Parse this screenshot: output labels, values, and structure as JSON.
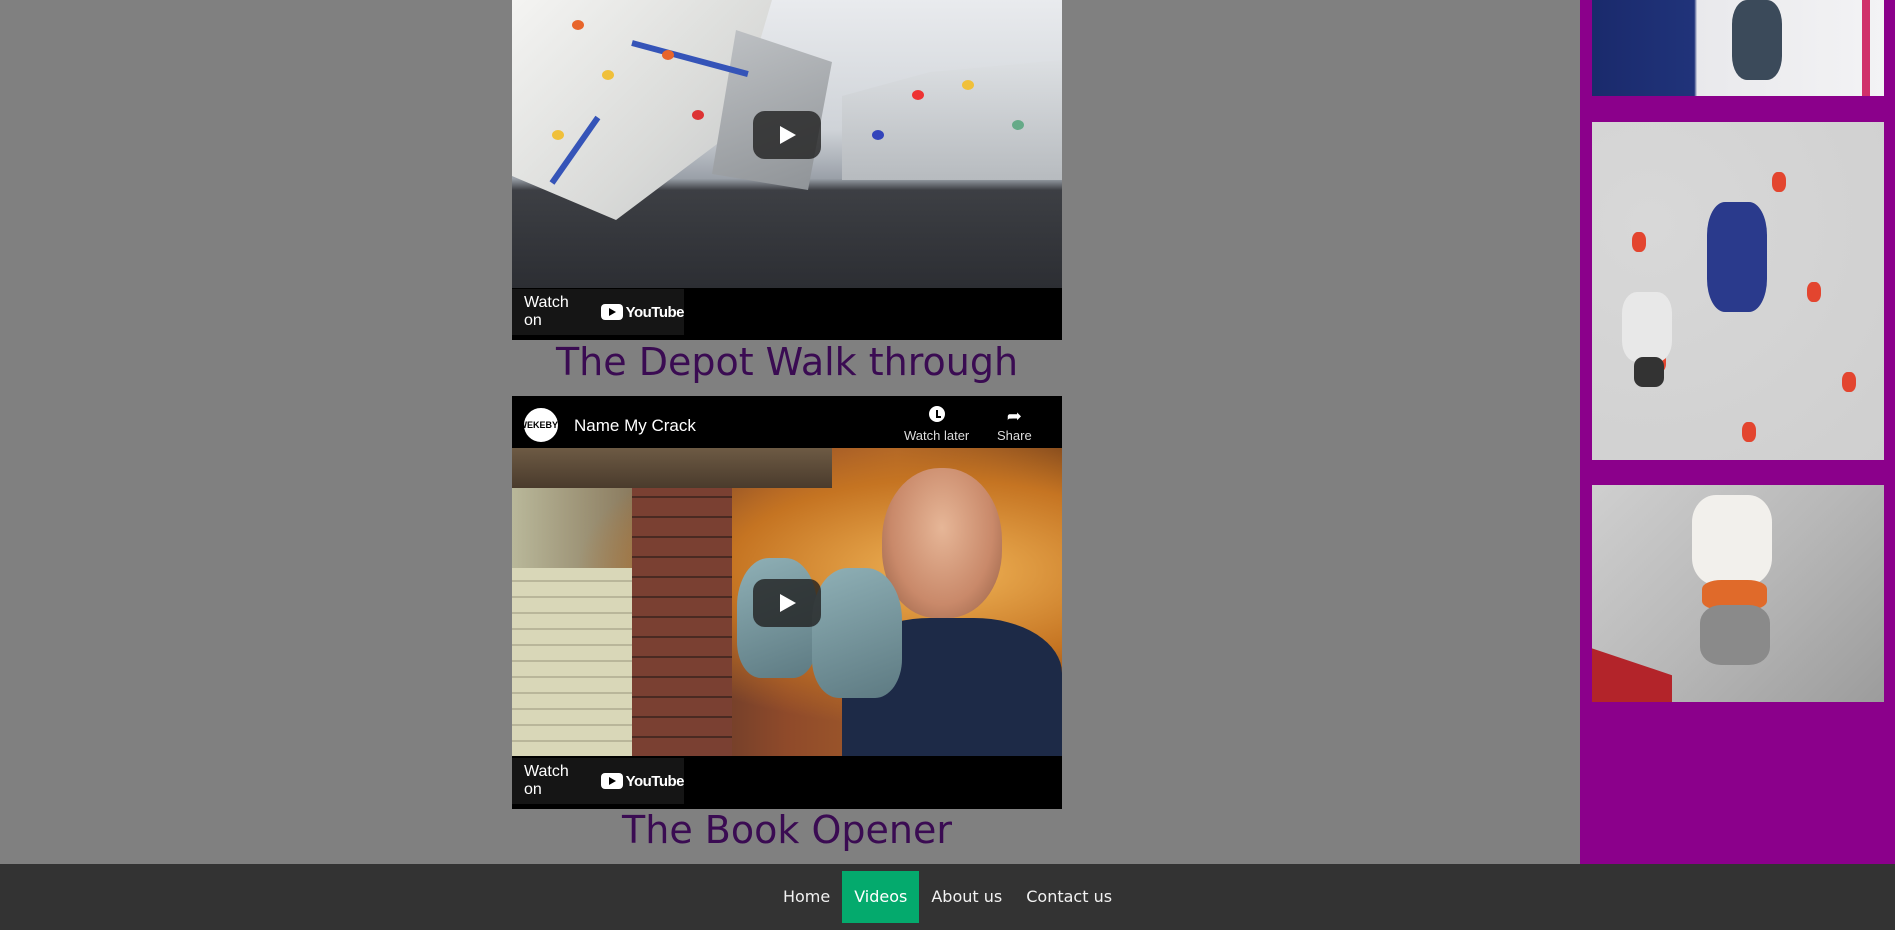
{
  "videos": [
    {
      "watch_on_label": "Watch on",
      "youtube_label": "YouTube",
      "caption": "The Depot Walk through"
    },
    {
      "channel_avatar_text": "WEKEBYT",
      "title": "Name My Crack",
      "watch_later_label": "Watch later",
      "share_label": "Share",
      "watch_on_label": "Watch on",
      "youtube_label": "YouTube",
      "caption": "The Book Opener"
    }
  ],
  "nav": {
    "items": [
      {
        "label": "Home"
      },
      {
        "label": "Videos"
      },
      {
        "label": "About us"
      },
      {
        "label": "Contact us"
      }
    ],
    "active": "Videos"
  },
  "colors": {
    "page_background": "#808080",
    "sidebar_background": "#8b008b",
    "heading_color": "#3a0b52",
    "nav_background": "#333333",
    "nav_active": "#04aa6d"
  }
}
